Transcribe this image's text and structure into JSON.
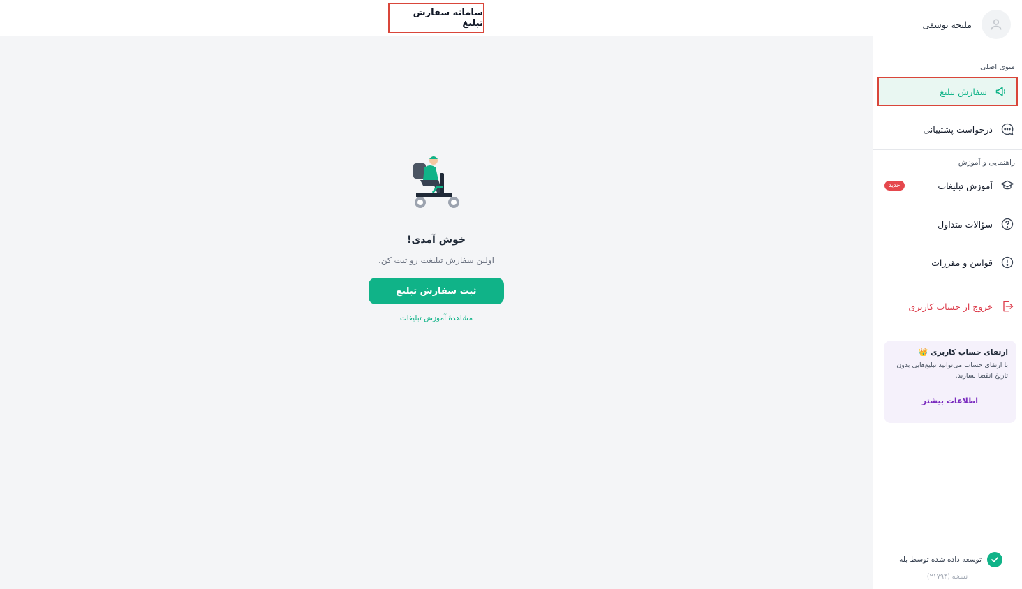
{
  "header": {
    "title": "سامانه سفارش تبلیغ"
  },
  "profile": {
    "name": "ملیحه یوسفی",
    "icon": "user-icon"
  },
  "sidebar": {
    "main_section_label": "منوی اصلی",
    "main_items": [
      {
        "label": "سفارش تبلیغ",
        "icon": "megaphone-icon",
        "active": true
      },
      {
        "label": "درخواست پشتیبانی",
        "icon": "chat-icon"
      }
    ],
    "help_section_label": "راهنمایی و آموزش",
    "help_items": [
      {
        "label": "آموزش تبلیغات",
        "icon": "graduation-cap-icon",
        "badge": "جدید"
      },
      {
        "label": "سؤالات متداول",
        "icon": "question-icon"
      },
      {
        "label": "قوانین و مقررات",
        "icon": "info-icon"
      }
    ],
    "logout": {
      "label": "خروج از حساب کاربری",
      "icon": "logout-icon"
    }
  },
  "upgrade": {
    "title": "ارتقای حساب کاربری 👑",
    "text": "با ارتقای حساب می‌توانید تبلیغ‌هایی بدون تاریخ انقضا بسازید.",
    "link": "اطلاعات بیشتر"
  },
  "footer": {
    "developed_by": "توسعه داده شده توسط بله",
    "version": "نسخه (۲۱۷۹۴)"
  },
  "empty_state": {
    "welcome": "خوش آمدی!",
    "subtext": "اولین سفارش تبلیغت رو ثبت کن.",
    "cta": "ثبت سفارش تبلیغ",
    "tutorial_link": "مشاهدهٔ آموزش تبلیغات"
  },
  "colors": {
    "accent": "#10b388",
    "danger": "#dc3b4a",
    "highlight_border": "#d9463a",
    "upgrade_bg": "#f5f1fb",
    "upgrade_link": "#7b2cbf"
  }
}
